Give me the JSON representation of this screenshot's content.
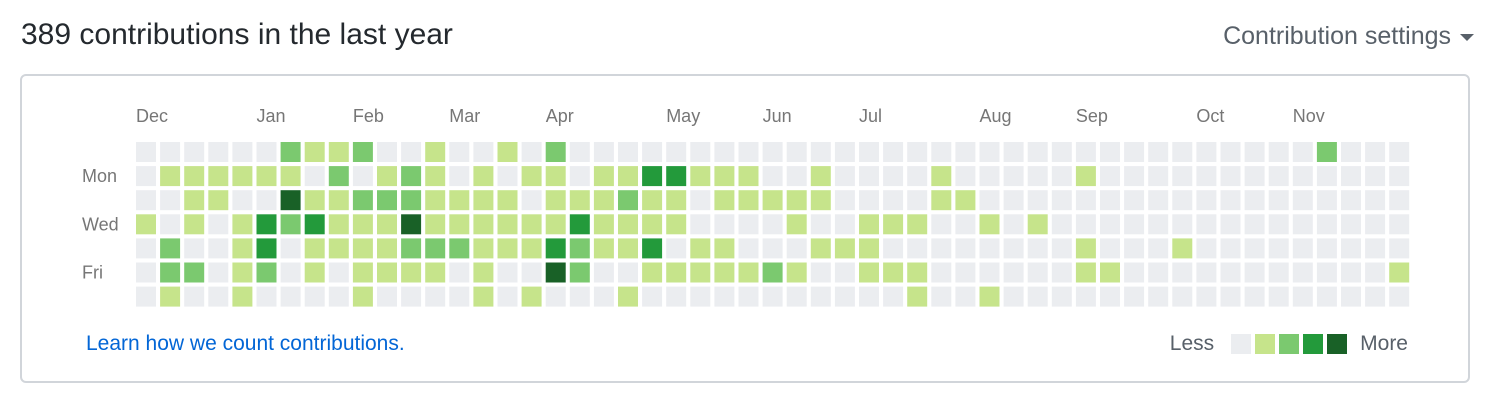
{
  "header": {
    "title": "389 contributions in the last year",
    "settings_label": "Contribution settings"
  },
  "graph": {
    "months": [
      {
        "label": "Dec",
        "week": 0
      },
      {
        "label": "Jan",
        "week": 5
      },
      {
        "label": "Feb",
        "week": 9
      },
      {
        "label": "Mar",
        "week": 13
      },
      {
        "label": "Apr",
        "week": 17
      },
      {
        "label": "May",
        "week": 22
      },
      {
        "label": "Jun",
        "week": 26
      },
      {
        "label": "Jul",
        "week": 30
      },
      {
        "label": "Aug",
        "week": 35
      },
      {
        "label": "Sep",
        "week": 39
      },
      {
        "label": "Oct",
        "week": 44
      },
      {
        "label": "Nov",
        "week": 48
      }
    ],
    "day_labels": [
      {
        "label": "Mon",
        "row": 1
      },
      {
        "label": "Wed",
        "row": 3
      },
      {
        "label": "Fri",
        "row": 5
      }
    ],
    "colors": [
      "#ebedf0",
      "#c6e48b",
      "#7bc96f",
      "#239a3b",
      "#196127"
    ],
    "levels": [
      "00000021120010010200000000000000000000000000000002000",
      "01111110201210101101133111001000010000010000000000000",
      "00110041122211110111211011111000011000000000000000000",
      "10101323111411111131111000010011100101000000000000000",
      "02001301111222111321130110001110000000010001000000000",
      "02201201011110100420011111210011100000011000000000001",
      "01001000010000101000100000000000100100000000000000000"
    ]
  },
  "footer": {
    "link_label": "Learn how we count contributions.",
    "legend_less": "Less",
    "legend_more": "More"
  }
}
